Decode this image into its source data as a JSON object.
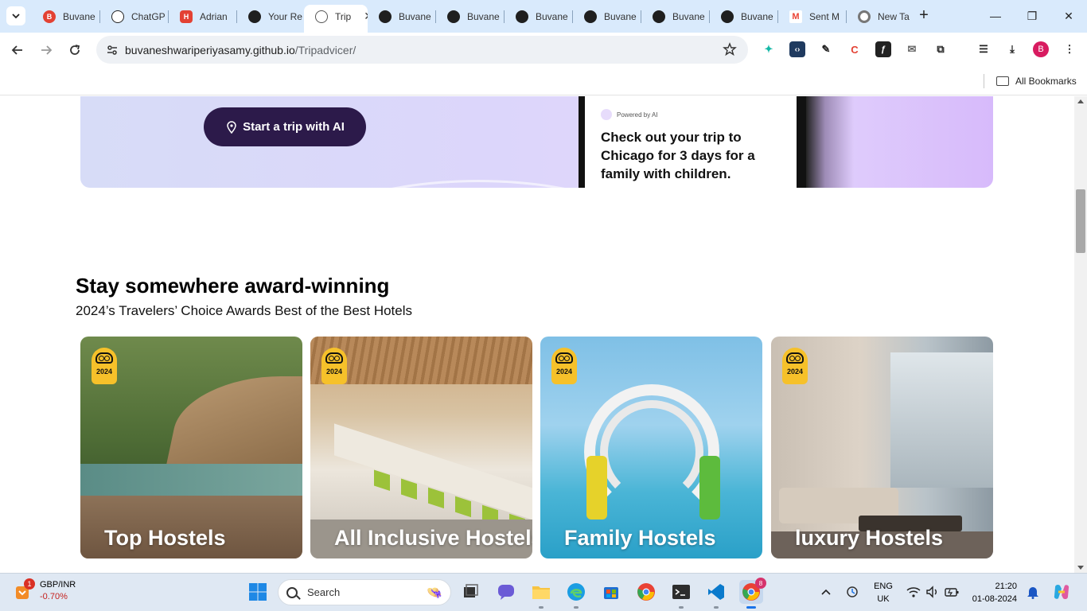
{
  "browser": {
    "tabs": [
      {
        "title": "Buvane",
        "favicon": "b-red-icon",
        "color": "#e34133"
      },
      {
        "title": "ChatGP",
        "favicon": "chatgpt-icon",
        "color": "#222222"
      },
      {
        "title": "Adrian",
        "favicon": "h-red-icon",
        "color": "#e34133"
      },
      {
        "title": "Your Re",
        "favicon": "github-icon",
        "color": "#1f1f1f"
      },
      {
        "title": "Trip",
        "favicon": "globe-icon",
        "color": "#555555",
        "active": true
      },
      {
        "title": "Buvane",
        "favicon": "github-icon",
        "color": "#1f1f1f"
      },
      {
        "title": "Buvane",
        "favicon": "github-icon",
        "color": "#1f1f1f"
      },
      {
        "title": "Buvane",
        "favicon": "github-icon",
        "color": "#1f1f1f"
      },
      {
        "title": "Buvane",
        "favicon": "github-icon",
        "color": "#1f1f1f"
      },
      {
        "title": "Buvane",
        "favicon": "github-icon",
        "color": "#1f1f1f"
      },
      {
        "title": "Buvane",
        "favicon": "github-icon",
        "color": "#1f1f1f"
      },
      {
        "title": "Sent M",
        "favicon": "gmail-icon",
        "color": "#ea4335"
      },
      {
        "title": "New Ta",
        "favicon": "chrome-icon",
        "color": "#555555"
      }
    ],
    "url_host": "buvaneshwariperiyasamy.github.io",
    "url_path": "/Tripadvicer/",
    "profile_initial": "B",
    "bookmarks_label": "All Bookmarks"
  },
  "page": {
    "ai_banner": {
      "button_label": "Start a trip with AI",
      "powered_by": "Powered by AI",
      "message": "Check out your trip to Chicago for 3 days for a family with children."
    },
    "section": {
      "title": "Stay somewhere award-winning",
      "subtitle": "2024’s Travelers’ Choice Awards Best of the Best Hotels"
    },
    "cards": [
      {
        "label": "Top Hostels",
        "badge_year": "2024"
      },
      {
        "label": "All Inclusive Hostels",
        "badge_year": "2024"
      },
      {
        "label": "Family Hostels",
        "badge_year": "2024"
      },
      {
        "label": "luxury Hostels",
        "badge_year": "2024"
      }
    ]
  },
  "taskbar": {
    "ticker_badge": "1",
    "ticker_name": "GBP/INR",
    "ticker_change": "-0.70%",
    "search_placeholder": "Search",
    "language_line1": "ENG",
    "language_line2": "UK",
    "time": "21:20",
    "date": "01-08-2024",
    "chrome_badge": "8"
  }
}
